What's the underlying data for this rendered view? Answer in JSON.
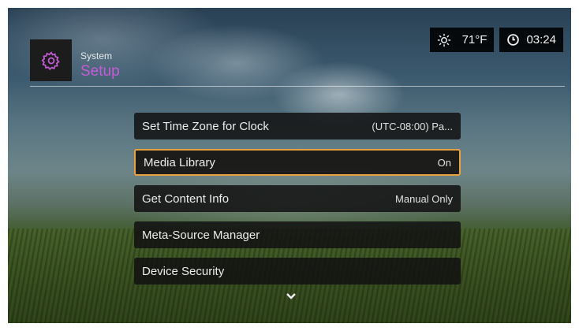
{
  "header": {
    "subtitle": "System",
    "title": "Setup",
    "icon": "gear-icon",
    "accent": "#c45cd8"
  },
  "status": {
    "weather_icon": "sun-icon",
    "temperature": "71°F",
    "clock_icon": "clock-icon",
    "time": "03:24"
  },
  "menu": {
    "selected_color": "#e8a040",
    "items": [
      {
        "label": "Set Time Zone for Clock",
        "value": "(UTC-08:00) Pa..."
      },
      {
        "label": "Media Library",
        "value": "On"
      },
      {
        "label": "Get Content Info",
        "value": "Manual Only"
      },
      {
        "label": "Meta-Source Manager",
        "value": ""
      },
      {
        "label": "Device Security",
        "value": ""
      }
    ],
    "more_icon": "chevron-down-icon"
  }
}
